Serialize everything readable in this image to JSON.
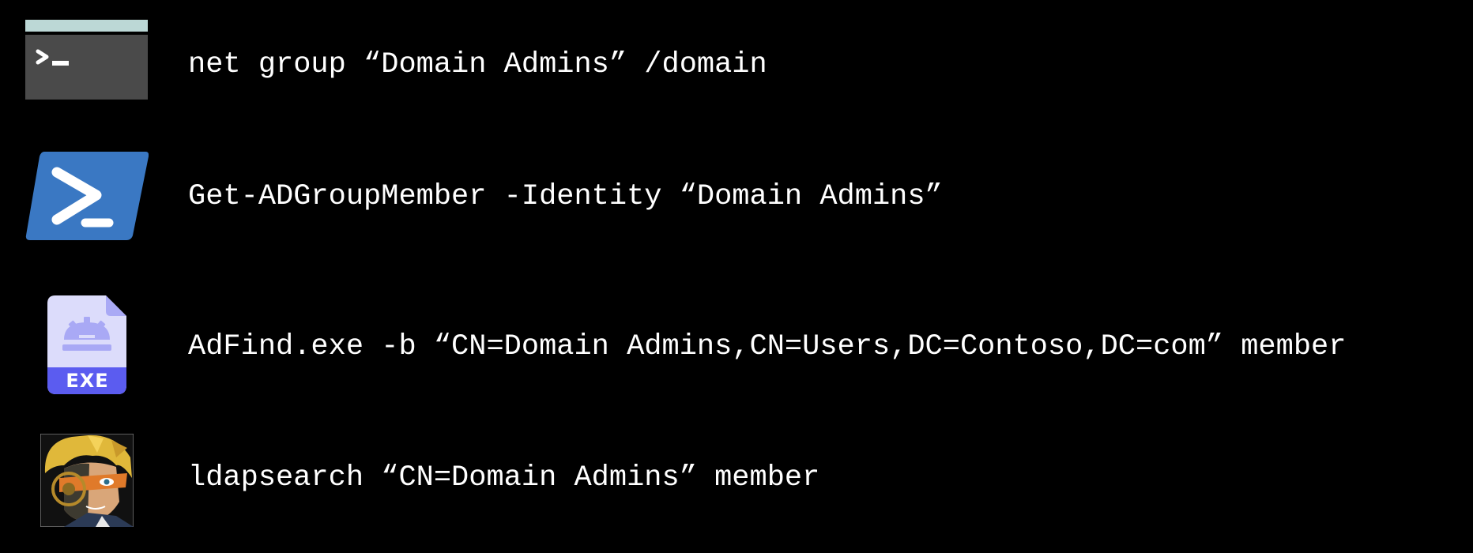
{
  "commands": [
    {
      "tool_icon": "cmd-terminal-icon",
      "text": "net group “Domain Admins” /domain"
    },
    {
      "tool_icon": "powershell-icon",
      "text": "Get-ADGroupMember -Identity “Domain Admins”"
    },
    {
      "tool_icon": "exe-file-icon",
      "icon_label": "EXE",
      "text": "AdFind.exe -b “CN=Domain Admins,CN=Users,DC=Contoso,DC=com” member"
    },
    {
      "tool_icon": "ldapsearch-avatar-icon",
      "text": "ldapsearch “CN=Domain Admins” member"
    }
  ],
  "colors": {
    "background": "#000000",
    "text": "#ffffff",
    "terminal_body": "#4a4a4a",
    "terminal_bar": "#bcd8d6",
    "powershell_blue": "#3a78c3",
    "exe_body": "#dcdcfb",
    "exe_band": "#5b5cf0"
  }
}
